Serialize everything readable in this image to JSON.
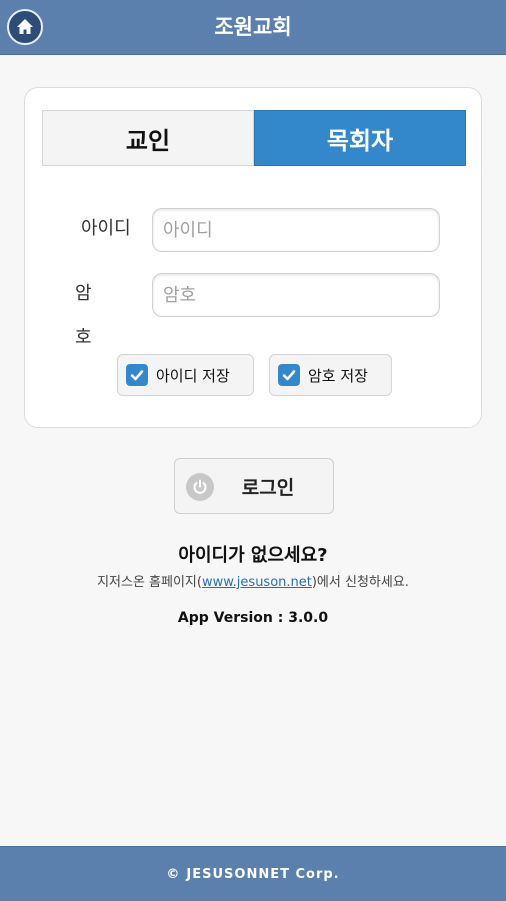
{
  "header": {
    "title": "조원교회",
    "home_icon": "home-icon"
  },
  "tabs": [
    {
      "label": "교인",
      "selected": false
    },
    {
      "label": "목회자",
      "selected": true
    }
  ],
  "form": {
    "id_label": "아이디",
    "id_placeholder": "아이디",
    "id_value": "",
    "pw_label": "암호",
    "pw_placeholder": "암호",
    "pw_value": "",
    "save_id_label": "아이디 저장",
    "save_id_checked": true,
    "save_pw_label": "암호 저장",
    "save_pw_checked": true
  },
  "login": {
    "label": "로그인",
    "icon": "power-icon"
  },
  "signup": {
    "title": "아이디가 없으세요?",
    "desc_prefix": "지저스온 홈페이지(",
    "link_text": "www.jesuson.net",
    "desc_suffix": ")에서 신청하세요."
  },
  "version": "App Version : 3.0.0",
  "footer": {
    "copyright_symbol": "©",
    "text": "JESUSONNET Corp."
  },
  "colors": {
    "header_bg": "#5b80ad",
    "accent": "#3388cc"
  }
}
